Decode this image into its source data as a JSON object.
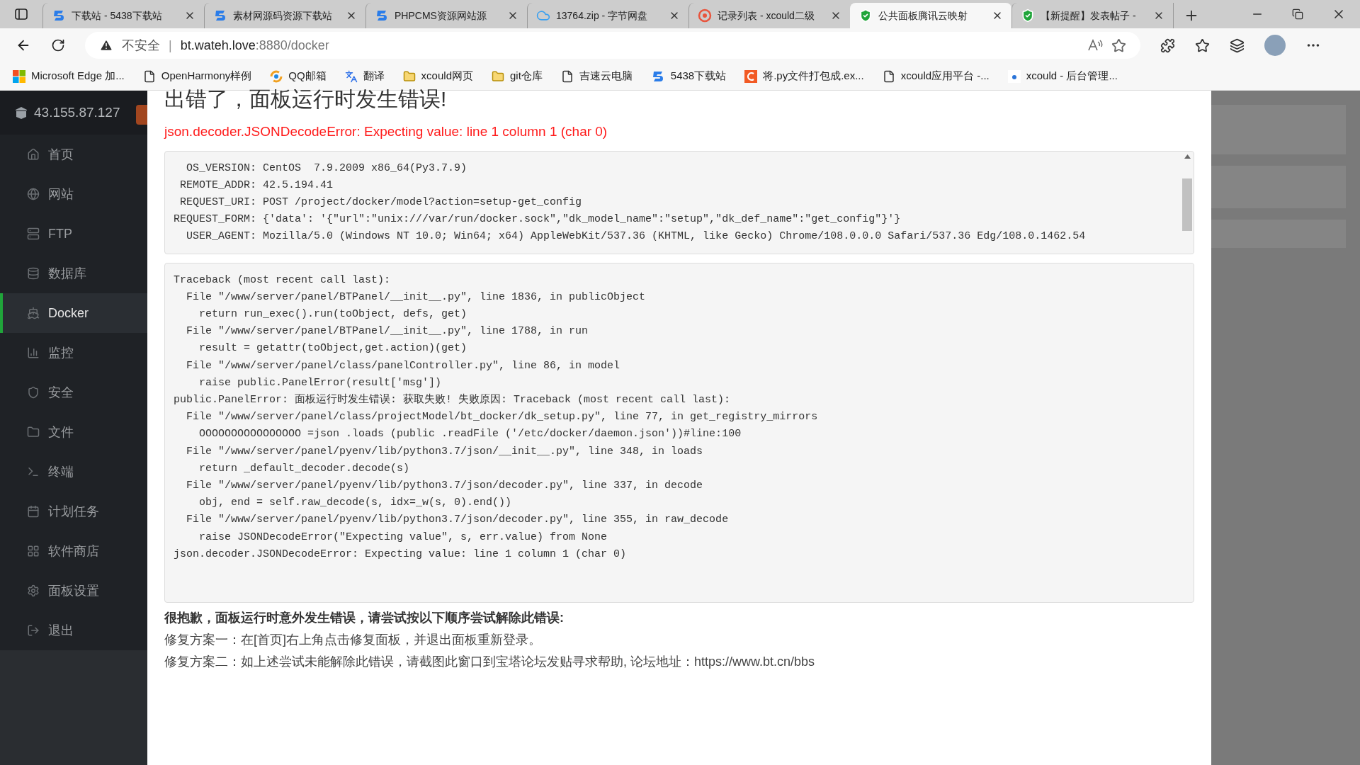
{
  "browser": {
    "tabs": [
      {
        "title": "下载站 - 5438下载站",
        "kind": "swirl",
        "selected": false
      },
      {
        "title": "素材网源码资源下载站",
        "kind": "swirl",
        "selected": false
      },
      {
        "title": "PHPCMS资源网站源",
        "kind": "swirl",
        "selected": false
      },
      {
        "title": "13764.zip - 字节网盘",
        "kind": "cloud",
        "selected": false
      },
      {
        "title": "记录列表 - xcould二级",
        "kind": "dns",
        "selected": false
      },
      {
        "title": "公共面板腾讯云映射",
        "kind": "shield",
        "selected": true
      },
      {
        "title": "【新提醒】发表帖子 -",
        "kind": "shield",
        "selected": false
      }
    ],
    "address": {
      "security": "不安全",
      "separator": "|",
      "host": "bt.wateh.love",
      "rest": ":8880/docker"
    },
    "bookmarks": [
      {
        "label": "Microsoft Edge 加...",
        "kind": "windows"
      },
      {
        "label": "OpenHarmony样例",
        "kind": "page"
      },
      {
        "label": "QQ邮箱",
        "kind": "ring"
      },
      {
        "label": "翻译",
        "kind": "translate"
      },
      {
        "label": "xcould网页",
        "kind": "folder"
      },
      {
        "label": "git仓库",
        "kind": "folder"
      },
      {
        "label": "吉速云电脑",
        "kind": "page"
      },
      {
        "label": "5438下载站",
        "kind": "swirl"
      },
      {
        "label": "将.py文件打包成.ex...",
        "kind": "orange"
      },
      {
        "label": "xcould应用平台 -...",
        "kind": "page"
      },
      {
        "label": "xcould - 后台管理...",
        "kind": "small"
      }
    ]
  },
  "sidebar": {
    "server_ip": "43.155.87.127",
    "items": [
      {
        "label": "首页",
        "kind": "home",
        "selected": false
      },
      {
        "label": "网站",
        "kind": "globe",
        "selected": false
      },
      {
        "label": "FTP",
        "kind": "ftp",
        "selected": false
      },
      {
        "label": "数据库",
        "kind": "database",
        "selected": false
      },
      {
        "label": "Docker",
        "kind": "docker",
        "selected": true
      },
      {
        "label": "监控",
        "kind": "monitor",
        "selected": false
      },
      {
        "label": "安全",
        "kind": "shield",
        "selected": false
      },
      {
        "label": "文件",
        "kind": "folder",
        "selected": false
      },
      {
        "label": "终端",
        "kind": "terminal",
        "selected": false
      },
      {
        "label": "计划任务",
        "kind": "calendar",
        "selected": false
      },
      {
        "label": "软件商店",
        "kind": "grid",
        "selected": false
      },
      {
        "label": "面板设置",
        "kind": "gear",
        "selected": false
      },
      {
        "label": "退出",
        "kind": "logout",
        "selected": false
      }
    ]
  },
  "dialog": {
    "title": "出错了，面板运行时发生错误!",
    "error": "json.decoder.JSONDecodeError: Expecting value: line 1 column 1 (char 0)",
    "request_info": [
      "  OS_VERSION: CentOS  7.9.2009 x86_64(Py3.7.9)",
      " REMOTE_ADDR: 42.5.194.41",
      " REQUEST_URI: POST /project/docker/model?action=setup-get_config",
      "REQUEST_FORM: {'data': '{\"url\":\"unix:///var/run/docker.sock\",\"dk_model_name\":\"setup\",\"dk_def_name\":\"get_config\"}'}",
      "  USER_AGENT: Mozilla/5.0 (Windows NT 10.0; Win64; x64) AppleWebKit/537.36 (KHTML, like Gecko) Chrome/108.0.0.0 Safari/537.36 Edg/108.0.1462.54"
    ],
    "traceback": [
      "Traceback (most recent call last):",
      "  File \"/www/server/panel/BTPanel/__init__.py\", line 1836, in publicObject",
      "    return run_exec().run(toObject, defs, get)",
      "  File \"/www/server/panel/BTPanel/__init__.py\", line 1788, in run",
      "    result = getattr(toObject,get.action)(get)",
      "  File \"/www/server/panel/class/panelController.py\", line 86, in model",
      "    raise public.PanelError(result['msg'])",
      "public.PanelError: 面板运行时发生错误: 获取失败! 失败原因: Traceback (most recent call last):",
      "  File \"/www/server/panel/class/projectModel/bt_docker/dk_setup.py\", line 77, in get_registry_mirrors",
      "    OOOOOOOOOOOOOOOO =json .loads (public .readFile ('/etc/docker/daemon.json'))#line:100",
      "  File \"/www/server/panel/pyenv/lib/python3.7/json/__init__.py\", line 348, in loads",
      "    return _default_decoder.decode(s)",
      "  File \"/www/server/panel/pyenv/lib/python3.7/json/decoder.py\", line 337, in decode",
      "    obj, end = self.raw_decode(s, idx=_w(s, 0).end())",
      "  File \"/www/server/panel/pyenv/lib/python3.7/json/decoder.py\", line 355, in raw_decode",
      "    raise JSONDecodeError(\"Expecting value\", s, err.value) from None",
      "json.decoder.JSONDecodeError: Expecting value: line 1 column 1 (char 0)"
    ],
    "help_heading": "很抱歉，面板运行时意外发生错误，请尝试按以下顺序尝试解除此错误:",
    "help_lines": [
      "修复方案一：在[首页]右上角点击修复面板，并退出面板重新登录。",
      "修复方案二：如上述尝试未能解除此错误，请截图此窗口到宝塔论坛发贴寻求帮助, 论坛地址：https://www.bt.cn/bbs"
    ]
  }
}
